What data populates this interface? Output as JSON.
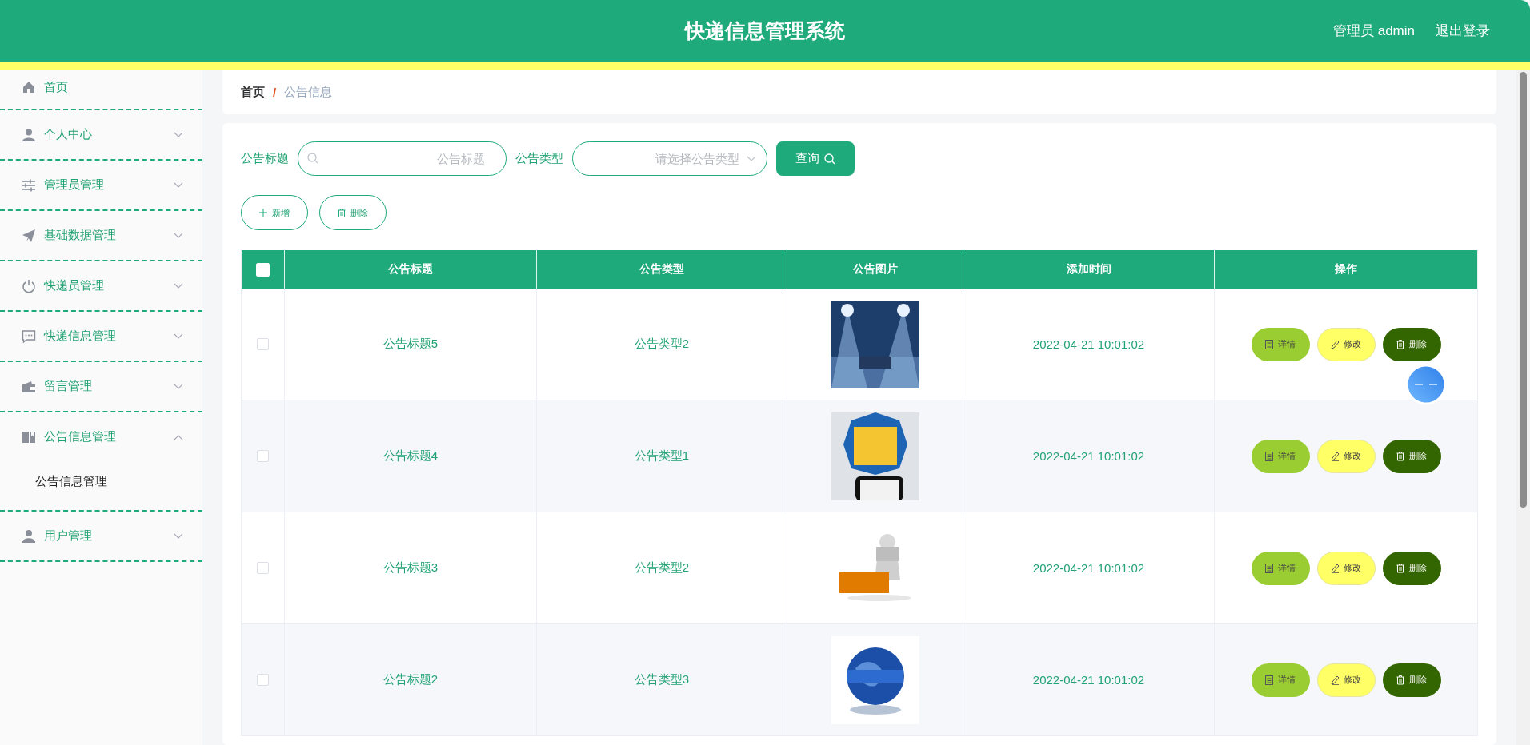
{
  "header": {
    "title": "快递信息管理系统",
    "user": "管理员 admin",
    "logout": "退出登录"
  },
  "sidebar": {
    "items": [
      {
        "label": "首页",
        "kind": "link"
      },
      {
        "label": "个人中心",
        "kind": "menu",
        "expanded": false
      },
      {
        "label": "管理员管理",
        "kind": "menu",
        "expanded": false
      },
      {
        "label": "基础数据管理",
        "kind": "menu",
        "expanded": false
      },
      {
        "label": "快递员管理",
        "kind": "menu",
        "expanded": false
      },
      {
        "label": "快递信息管理",
        "kind": "menu",
        "expanded": false
      },
      {
        "label": "留言管理",
        "kind": "menu",
        "expanded": false
      },
      {
        "label": "公告信息管理",
        "kind": "menu",
        "expanded": true,
        "children": [
          {
            "label": "公告信息管理"
          }
        ]
      },
      {
        "label": "用户管理",
        "kind": "menu",
        "expanded": false
      }
    ]
  },
  "breadcrumb": [
    "首页",
    "/",
    "公告信息"
  ],
  "search": {
    "title_label": "公告标题",
    "title_placeholder": "公告标题",
    "type_label": "公告类型",
    "type_placeholder": "请选择公告类型",
    "query_button": "查询"
  },
  "actions": [
    "新增",
    "删除"
  ],
  "table": {
    "header_checked": false,
    "columns": [
      "公告标题",
      "公告类型",
      "公告图片",
      "添加时间",
      "操作"
    ],
    "rows": [
      {
        "checked": false,
        "title": "公告标题5",
        "type": "公告类型2",
        "time": "2022-04-21 10:01:02",
        "buttons": [
          "详情",
          "修改",
          "删除"
        ]
      },
      {
        "checked": false,
        "title": "公告标题4",
        "type": "公告类型1",
        "time": "2022-04-21 10:01:02",
        "buttons": [
          "详情",
          "修改",
          "删除"
        ]
      },
      {
        "checked": false,
        "title": "公告标题3",
        "type": "公告类型2",
        "time": "2022-04-21 10:01:02",
        "buttons": [
          "详情",
          "修改",
          "删除"
        ]
      },
      {
        "checked": false,
        "title": "公告标题2",
        "type": "公告类型3",
        "time": "2022-04-21 10:01:02",
        "buttons": [
          "详情",
          "修改",
          "删除"
        ]
      }
    ]
  }
}
